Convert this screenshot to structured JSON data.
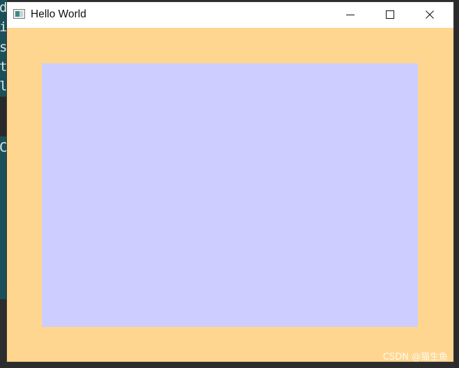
{
  "background_terminal": {
    "lines": [
      "d",
      "i",
      "s",
      "t",
      "l",
      "C"
    ]
  },
  "window": {
    "title": "Hello World",
    "controls": {
      "minimize": "minimize",
      "maximize": "maximize",
      "close": "close"
    }
  },
  "colors": {
    "client_background": "#ffd68f",
    "inner_panel": "#cdcdff",
    "titlebar": "#ffffff"
  },
  "watermark": "CSDN @猫生鱼"
}
